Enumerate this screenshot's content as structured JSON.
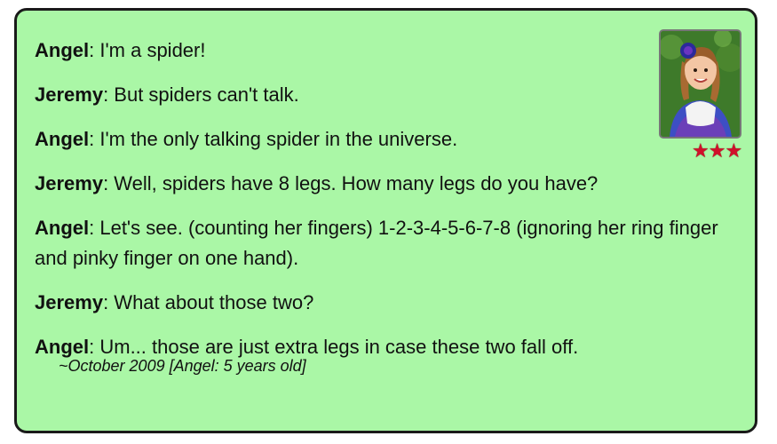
{
  "quote": {
    "lines": [
      {
        "speaker": "Angel",
        "text": ": I'm a spider!"
      },
      {
        "speaker": "Jeremy",
        "text": ": But spiders can't talk."
      },
      {
        "speaker": "Angel",
        "text": ": I'm the only talking spider in the universe."
      },
      {
        "speaker": "Jeremy",
        "text": ": Well, spiders have 8 legs. How many legs do you have?"
      },
      {
        "speaker": "Angel",
        "text": ": Let's see. (counting her fingers) 1-2-3-4-5-6-7-8 (ignoring her ring finger and pinky finger on one hand)."
      },
      {
        "speaker": "Jeremy",
        "text": ": What about those two?"
      },
      {
        "speaker": "Angel",
        "text": ": Um... those are just extra legs in case these two fall off."
      }
    ],
    "date": "~October 2009 [Angel: 5 years old]"
  },
  "rating": {
    "stars": "★★★",
    "value": 3,
    "color": "#d0102a"
  },
  "colors": {
    "card_background": "#aaf7a6",
    "border": "#1a1a1a"
  }
}
